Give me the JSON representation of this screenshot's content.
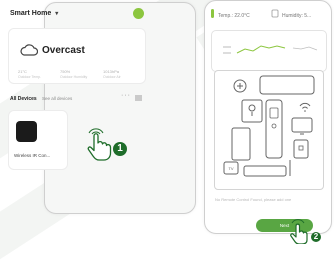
{
  "home": {
    "title": "Smart Home",
    "weather": {
      "condition": "Overcast",
      "stats": [
        {
          "value": "21°C",
          "label": "Outdoor Temp."
        },
        {
          "value": "750%",
          "label": "Outdoor Humidity"
        },
        {
          "value": "1013hPa",
          "label": "Outdoor Air"
        }
      ]
    },
    "tabs": [
      "All Devices",
      "See all devices"
    ],
    "device": {
      "label": "Wireless IR Con..."
    }
  },
  "device_page": {
    "temperature": "Temp.: 22.0°C",
    "humidity": "Humidity: 5...",
    "help_text": "No Remote Control Found, please add one",
    "next_button": "Next"
  },
  "step_badges": [
    "1",
    "2"
  ],
  "colors": {
    "accent_green": "#8cc63f",
    "button_green": "#59a643",
    "badge_green": "#1f6d2a"
  }
}
